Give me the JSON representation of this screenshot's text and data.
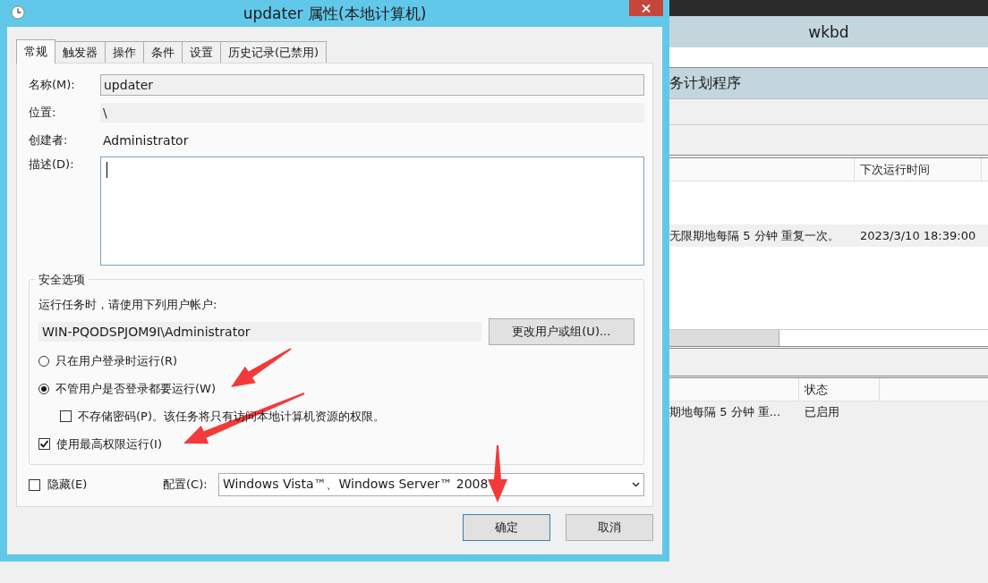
{
  "dialog": {
    "title": "updater 属性(本地计算机)",
    "tabs": [
      {
        "label": "常规",
        "selected": true
      },
      {
        "label": "触发器",
        "selected": false
      },
      {
        "label": "操作",
        "selected": false
      },
      {
        "label": "条件",
        "selected": false
      },
      {
        "label": "设置",
        "selected": false
      },
      {
        "label": "历史记录(已禁用)",
        "selected": false
      }
    ],
    "name": {
      "label": "名称(M):",
      "value": "updater"
    },
    "location": {
      "label": "位置:",
      "value": "\\"
    },
    "author": {
      "label": "创建者:",
      "value": "Administrator"
    },
    "description": {
      "label": "描述(D):"
    },
    "security": {
      "title": "安全选项",
      "prompt": "运行任务时，请使用下列用户帐户:",
      "account": "WIN-PQODSPJOM9I\\Administrator",
      "change_button": "更改用户或组(U)...",
      "options": [
        {
          "kind": "radio",
          "label": "只在用户登录时运行(R)",
          "selected": false
        },
        {
          "kind": "radio",
          "label": "不管用户是否登录都要运行(W)",
          "selected": true,
          "children": [
            {
              "kind": "checkbox",
              "label": "不存储密码(P)。该任务将只有访问本地计算机资源的权限。",
              "checked": false
            }
          ]
        },
        {
          "kind": "checkbox",
          "label": "使用最高权限运行(I)",
          "checked": true
        }
      ]
    },
    "hidden": {
      "label": "隐藏(E)",
      "checked": false
    },
    "config": {
      "label": "配置(C):",
      "value": "Windows Vista™、Windows Server™ 2008"
    },
    "buttons": [
      "确定",
      "取消"
    ]
  },
  "background_window": {
    "title": "wkbd",
    "section": "务计划程序",
    "upper_table": {
      "columns": [
        "",
        "下次运行时间"
      ],
      "rows": [
        {
          "cells": [
            "无限期地每隔 5 分钟 重复一次。",
            "2023/3/10 18:39:00"
          ]
        }
      ]
    },
    "lower_table": {
      "columns": [
        "",
        "状态"
      ],
      "rows": [
        {
          "cells": [
            "期地每隔 5 分钟 重...",
            "已启用"
          ]
        }
      ]
    }
  }
}
